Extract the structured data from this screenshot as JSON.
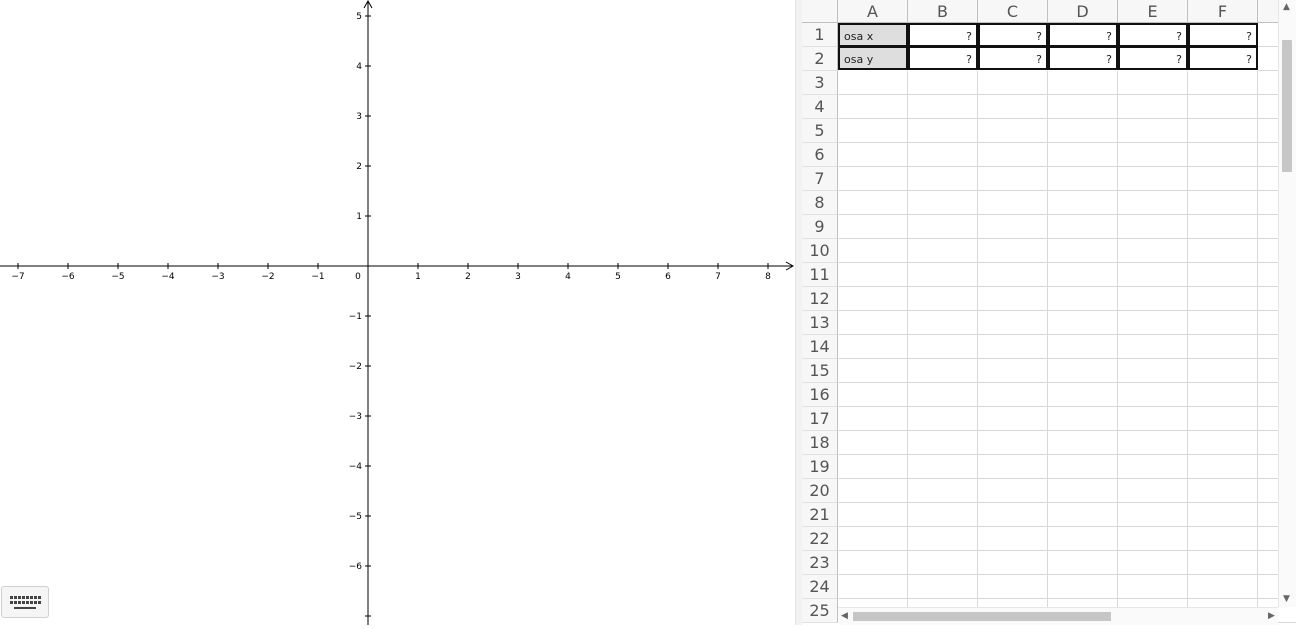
{
  "graphics": {
    "x_ticks": [
      "−7",
      "−6",
      "−5",
      "−4",
      "−3",
      "−2",
      "−1",
      "0",
      "1",
      "2",
      "3",
      "4",
      "5",
      "6",
      "7",
      "8"
    ],
    "y_ticks_positive": [
      "1",
      "2",
      "3",
      "4",
      "5"
    ],
    "y_ticks_negative": [
      "−1",
      "−2",
      "−3",
      "−4",
      "−5",
      "−6"
    ],
    "keyboard_icon": "keyboard-icon"
  },
  "spreadsheet": {
    "columns": [
      "A",
      "B",
      "C",
      "D",
      "E",
      "F"
    ],
    "rows": [
      "1",
      "2",
      "3",
      "4",
      "5",
      "6",
      "7",
      "8",
      "9",
      "10",
      "11",
      "12",
      "13",
      "14",
      "15",
      "16",
      "17",
      "18",
      "19",
      "20",
      "21",
      "22",
      "23",
      "24",
      "25"
    ],
    "row1": {
      "label": "osa x",
      "values": [
        "?",
        "?",
        "?",
        "?",
        "?"
      ]
    },
    "row2": {
      "label": "osa y",
      "values": [
        "?",
        "?",
        "?",
        "?",
        "?"
      ]
    }
  },
  "scrollbars": {
    "up_arrow": "▲",
    "down_arrow": "▼",
    "left_arrow": "◀",
    "right_arrow": "▶"
  }
}
